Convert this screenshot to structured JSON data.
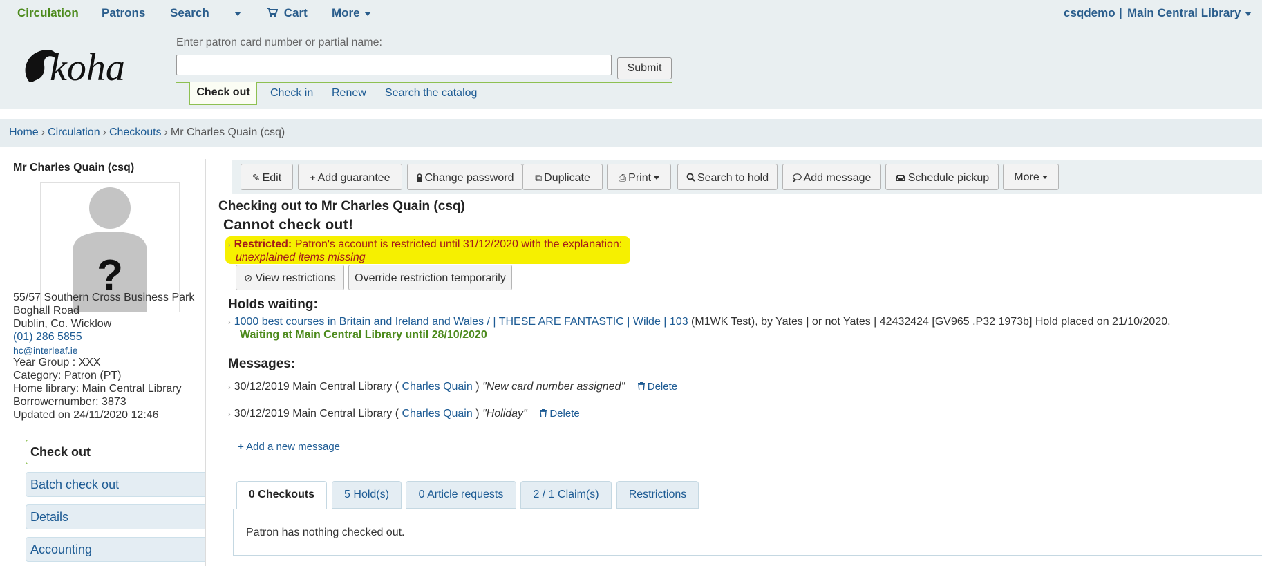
{
  "topnav": {
    "circulation": "Circulation",
    "patrons": "Patrons",
    "search": "Search",
    "cart": "Cart",
    "more": "More",
    "user": "csqdemo",
    "separator": "|",
    "library": "Main Central Library"
  },
  "header": {
    "logo_text": "koha",
    "patron_label": "Enter patron card number or partial name:",
    "patron_input_value": "",
    "submit": "Submit",
    "tabs": [
      "Check out",
      "Check in",
      "Renew",
      "Search the catalog"
    ]
  },
  "breadcrumb": {
    "home": "Home",
    "circulation": "Circulation",
    "checkouts": "Checkouts",
    "current": "Mr Charles Quain (csq)",
    "sep": "›"
  },
  "patron": {
    "name": "Mr Charles Quain (csq)",
    "address1": "55/57 Southern Cross Business Park",
    "address2": "Boghall Road",
    "address3": "Dublin, Co. Wicklow",
    "phone": "(01) 286 5855",
    "email": "hc@interleaf.ie",
    "year_group": "Year Group : XXX",
    "category": "Category: Patron (PT)",
    "home_library": "Home library: Main Central Library",
    "borrowernumber": "Borrowernumber: 3873",
    "updated": "Updated on 24/11/2020 12:46"
  },
  "sidebar_nav": [
    "Check out",
    "Batch check out",
    "Details",
    "Accounting"
  ],
  "toolbar": {
    "edit": "Edit",
    "add_guarantee": "Add guarantee",
    "change_password": "Change password",
    "duplicate": "Duplicate",
    "print": "Print",
    "search_to_hold": "Search to hold",
    "add_message": "Add message",
    "schedule_pickup": "Schedule pickup",
    "more": "More"
  },
  "main": {
    "checking_out_to": "Checking out to Mr Charles Quain (csq)",
    "cannot_check_out": "Cannot check out!",
    "restricted_label": "Restricted:",
    "restricted_text": "Patron's account is restricted until 31/12/2020 with the explanation:",
    "restricted_reason": "unexplained items missing",
    "view_restrictions": "View restrictions",
    "override_restriction": "Override restriction temporarily",
    "holds_heading": "Holds waiting:",
    "hold_title": "1000 best courses in Britain and Ireland and Wales / | THESE ARE FANTASTIC | Wilde | 103",
    "hold_details": "(M1WK Test), by Yates | or not Yates | 42432424 [GV965 .P32 1973b] Hold placed on 21/10/2020.",
    "hold_waiting": "Waiting at Main Central Library until 28/10/2020",
    "messages_heading": "Messages:",
    "messages": [
      {
        "prefix": "30/12/2019 Main Central Library (",
        "author": "Charles Quain",
        "suffix": ")",
        "text": "\"New card number assigned\"",
        "delete": "Delete"
      },
      {
        "prefix": "30/12/2019 Main Central Library (",
        "author": "Charles Quain",
        "suffix": ")",
        "text": "\"Holiday\"",
        "delete": "Delete"
      }
    ],
    "add_new_message": "Add a new message"
  },
  "tabs": [
    "0 Checkouts",
    "5 Hold(s)",
    "0 Article requests",
    "2 / 1 Claim(s)",
    "Restrictions"
  ],
  "tab_panel_text": "Patron has nothing checked out.",
  "colors": {
    "link": "#1d5b94",
    "green": "#4c8a1c",
    "highlight": "#f6f000",
    "restricted": "#a31a1a"
  }
}
